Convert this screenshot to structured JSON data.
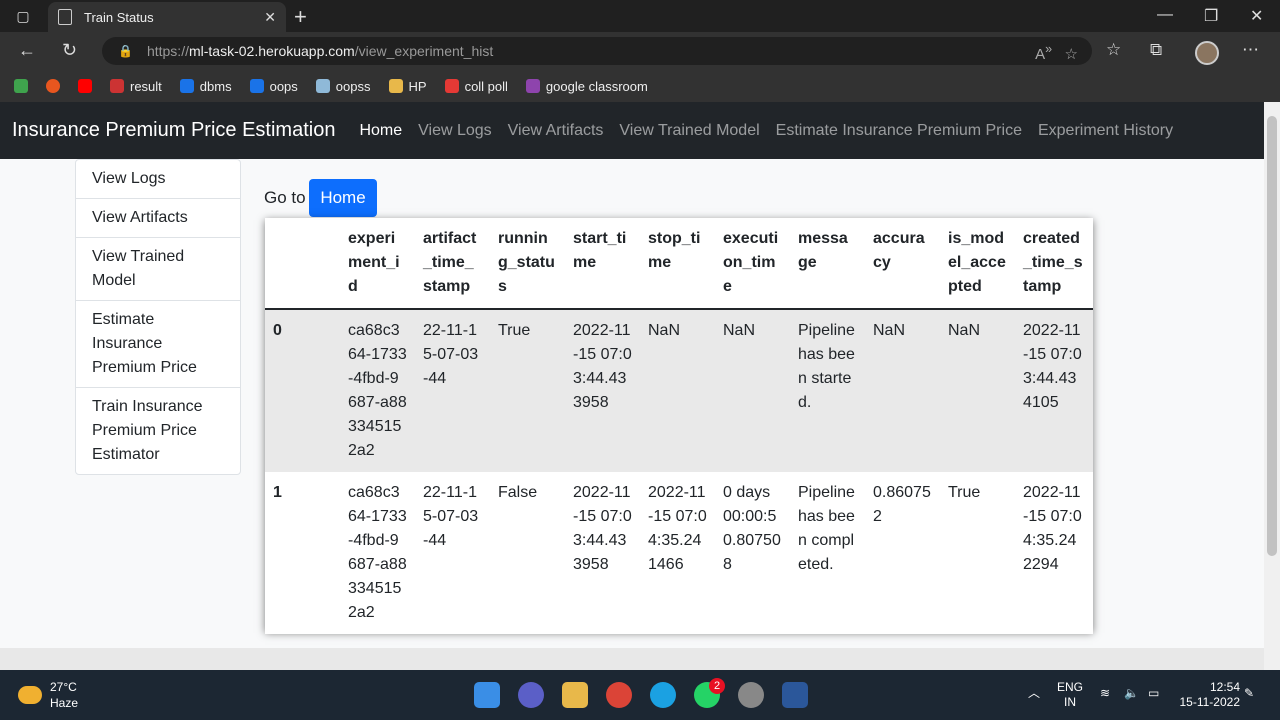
{
  "browser": {
    "tab_title": "Train Status",
    "url_prefix": "https://",
    "url_domain": "ml-task-02.herokuapp.com",
    "url_path": "/view_experiment_hist",
    "bookmarks": [
      {
        "label": "",
        "icon": "green-glyph-icon",
        "color": "#3fa34d"
      },
      {
        "label": "",
        "icon": "alert-icon",
        "color": "#e8561f"
      },
      {
        "label": "",
        "icon": "youtube-icon",
        "color": "#ff0000"
      },
      {
        "label": "result",
        "icon": "result-icon",
        "color": "#c33"
      },
      {
        "label": "dbms",
        "icon": "edge-e-icon",
        "color": "#1a73e8"
      },
      {
        "label": "oops",
        "icon": "edge-e-icon",
        "color": "#1a73e8"
      },
      {
        "label": "oopss",
        "icon": "mountain-icon",
        "color": "#8fb9d8"
      },
      {
        "label": "HP",
        "icon": "folder-icon",
        "color": "#e8b84a"
      },
      {
        "label": "coll poll",
        "icon": "chat-icon",
        "color": "#e53935"
      },
      {
        "label": "google classroom",
        "icon": "classroom-icon",
        "color": "#8e44ad"
      }
    ]
  },
  "navbar": {
    "brand": "Insurance Premium Price Estimation",
    "links": [
      "Home",
      "View Logs",
      "View Artifacts",
      "View Trained Model",
      "Estimate Insurance Premium Price",
      "Experiment History"
    ]
  },
  "sidebar": {
    "items": [
      "View Logs",
      "View Artifacts",
      "View Trained Model",
      "Estimate Insurance Premium Price",
      "Train Insurance Premium Price Estimator"
    ]
  },
  "goto": {
    "label": "Go to",
    "button": "Home"
  },
  "table": {
    "headers": [
      "",
      "experiment_id",
      "artifact_time_stamp",
      "running_status",
      "start_time",
      "stop_time",
      "execution_time",
      "message",
      "accuracy",
      "is_model_accepted",
      "created_time_stamp"
    ],
    "rows": [
      [
        "0",
        "ca68c364-1733-4fbd-9687-a883345152a2",
        "22-11-15-07-03-44",
        "True",
        "2022-11-15 07:03:44.433958",
        "NaN",
        "NaN",
        "Pipeline has been started.",
        "NaN",
        "NaN",
        "2022-11-15 07:03:44.434105"
      ],
      [
        "1",
        "ca68c364-1733-4fbd-9687-a883345152a2",
        "22-11-15-07-03-44",
        "False",
        "2022-11-15 07:03:44.433958",
        "2022-11-15 07:04:35.241466",
        "0 days 00:00:50.807508",
        "Pipeline has been completed.",
        "0.860752",
        "True",
        "2022-11-15 07:04:35.242294"
      ]
    ]
  },
  "taskbar": {
    "temp": "27°C",
    "condition": "Haze",
    "lang": "ENG",
    "region": "IN",
    "time": "12:54",
    "date": "15-11-2022",
    "whatsapp_badge": "2"
  }
}
